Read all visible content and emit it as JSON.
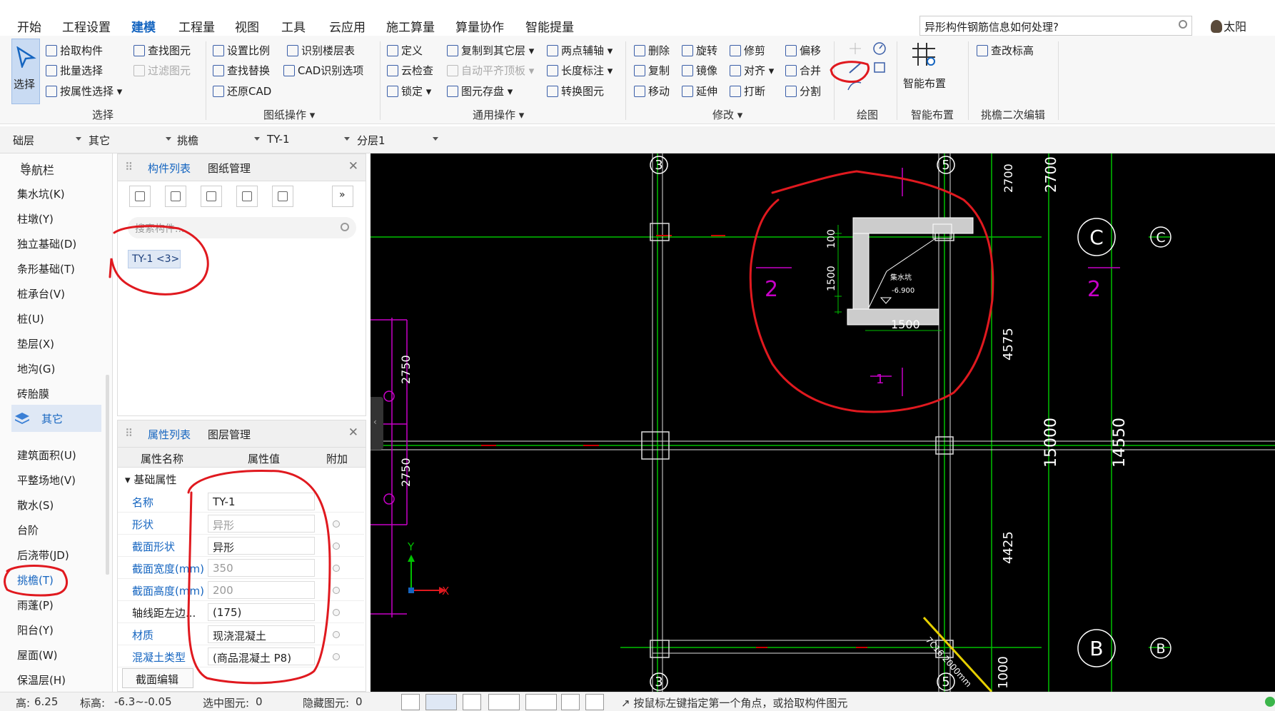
{
  "menu": {
    "tabs": [
      "开始",
      "工程设置",
      "建模",
      "工程量",
      "视图",
      "工具",
      "云应用",
      "施工算量",
      "算量协作",
      "智能提量"
    ],
    "active_tab": "建模",
    "search_text": "异形构件钢筋信息如何处理?",
    "user_name": "太阳"
  },
  "ribbon": {
    "select_button": "选择",
    "select": {
      "pick": "拾取构件",
      "batch": "批量选择",
      "by_prop": "按属性选择",
      "find": "查找图元",
      "filter": "过滤图元",
      "group": "选择"
    },
    "drawing": {
      "set_scale": "设置比例",
      "identify_floor": "识别楼层表",
      "find_replace": "查找替换",
      "cad_options": "CAD识别选项",
      "restore_cad": "还原CAD",
      "group": "图纸操作"
    },
    "general": {
      "define": "定义",
      "copy_to_floor": "复制到其它层",
      "two_point_axis": "两点辅轴",
      "cloud_check": "云检查",
      "auto_flush": "自动平齐顶板",
      "length_mark": "长度标注",
      "lock": "锁定",
      "save_element": "图元存盘",
      "convert_element": "转换图元",
      "group": "通用操作"
    },
    "modify": {
      "delete": "删除",
      "rotate": "旋转",
      "trim": "修剪",
      "offset": "偏移",
      "copy": "复制",
      "mirror": "镜像",
      "align": "对齐",
      "merge": "合并",
      "move": "移动",
      "extend": "延伸",
      "break": "打断",
      "split": "分割",
      "group": "修改"
    },
    "draw_group": "绘图",
    "smart_layout": "智能布置",
    "smart_layout_group": "智能布置",
    "check_elevation": "查改标高",
    "eave_edit_group": "挑檐二次编辑"
  },
  "dropdowns": {
    "floor": "础层",
    "category": "其它",
    "type": "挑檐",
    "component": "TY-1",
    "layer": "分层1"
  },
  "nav": {
    "title": "导航栏",
    "items": [
      "集水坑(K)",
      "柱墩(Y)",
      "独立基础(D)",
      "条形基础(T)",
      "桩承台(V)",
      "桩(U)",
      "垫层(X)",
      "地沟(G)",
      "砖胎膜"
    ],
    "section": "其它",
    "items2": [
      "建筑面积(U)",
      "平整场地(V)",
      "散水(S)",
      "台阶",
      "后浇带(JD)",
      "挑檐(T)",
      "雨蓬(P)",
      "阳台(Y)",
      "屋面(W)",
      "保温层(H)"
    ]
  },
  "component_panel": {
    "tab_list": "构件列表",
    "tab_drawings": "图纸管理",
    "search_placeholder": "搜索构件...",
    "item": "TY-1 <3>"
  },
  "property_panel": {
    "tab_props": "属性列表",
    "tab_layers": "图层管理",
    "col_name": "属性名称",
    "col_value": "属性值",
    "col_extra": "附加",
    "group": "基础属性",
    "rows": [
      {
        "name": "名称",
        "value": "TY-1"
      },
      {
        "name": "形状",
        "value": "异形"
      },
      {
        "name": "截面形状",
        "value": "异形"
      },
      {
        "name": "截面宽度(mm)",
        "value": "350"
      },
      {
        "name": "截面高度(mm)",
        "value": "200"
      },
      {
        "name": "轴线距左边...",
        "value": "(175)"
      },
      {
        "name": "材质",
        "value": "现浇混凝土"
      },
      {
        "name": "混凝土类型",
        "value": "(商品混凝土 P8)"
      }
    ],
    "section_edit": "截面编辑"
  },
  "canvas": {
    "axis_labels": {
      "top_left": "3",
      "top_right": "5",
      "bottom_left": "3",
      "bottom_right": "5",
      "c1": "C",
      "c2": "C",
      "b1": "B",
      "b2": "B"
    },
    "dims": {
      "d2700": "2700",
      "d2700b": "2700",
      "d2750a": "2750",
      "d2750b": "2750",
      "d4575": "4575",
      "d4425": "4425",
      "d14550": "14550",
      "d15000": "15000",
      "d100": "100",
      "d1500v": "1500",
      "d1500h": "1500",
      "d1000": "1000"
    },
    "section_marks": [
      "2",
      "2",
      "1"
    ],
    "detail_note_1": "集水坑",
    "detail_note_2": "-6.900",
    "diagonal_note": "7C16 2000mm",
    "axis_x": "X",
    "axis_y": "Y"
  },
  "status": {
    "floor_height_label": "高:",
    "floor_height": "6.25",
    "elevation_label": "标高:",
    "elevation": "-6.3~-0.05",
    "selected_label": "选中图元:",
    "selected": "0",
    "hidden_label": "隐藏图元:",
    "hidden": "0",
    "hint": "按鼠标左键指定第一个角点，或拾取构件图元"
  },
  "colors": {
    "accent": "#1565c0",
    "annotation": "#e0191f",
    "canvas_bg": "#000000",
    "axis_green": "#00c000",
    "magenta": "#c800c8"
  }
}
